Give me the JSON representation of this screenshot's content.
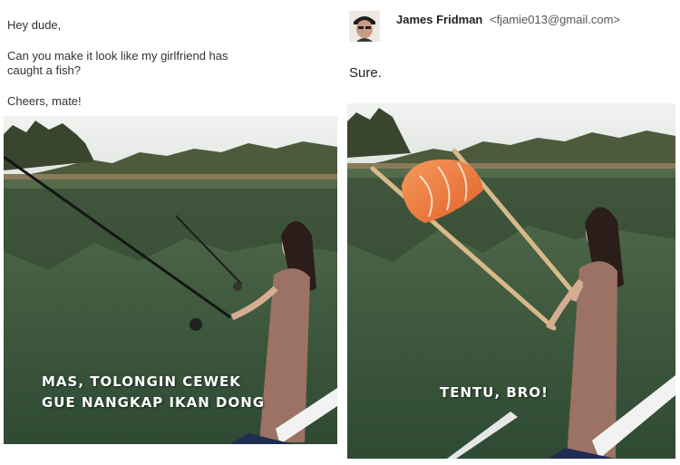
{
  "request": {
    "greeting": "Hey dude,",
    "line1": "Can you make it look like my girlfriend has",
    "line2": "caught a fish?",
    "signoff": "Cheers, mate!",
    "caption_line1": "MAS, TOLONGIN CEWEK",
    "caption_line2": "GUE NANGKAP IKAN DONG"
  },
  "reply": {
    "sender_name": "James Fridman",
    "sender_email": "<fjamie013@gmail.com>",
    "body": "Sure.",
    "caption": "TENTU, BRO!"
  },
  "colors": {
    "water": "#3d5a3c",
    "sky": "#e9ece8",
    "dress": "#9c7264",
    "salmon": "#f07a3a",
    "chopstick": "#d7b98a"
  }
}
